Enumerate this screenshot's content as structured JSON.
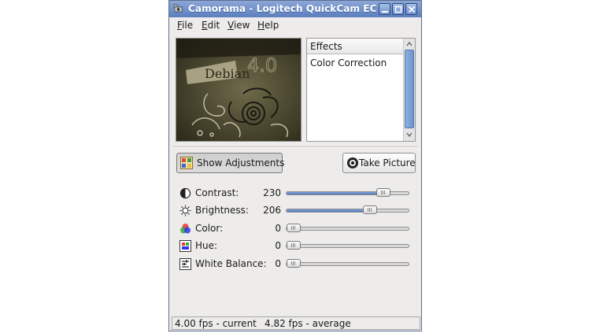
{
  "window": {
    "title": "Camorama - Logitech QuickCam EC"
  },
  "menubar": [
    {
      "label": "File",
      "mnemonic": "F",
      "rest": "ile"
    },
    {
      "label": "Edit",
      "mnemonic": "E",
      "rest": "dit"
    },
    {
      "label": "View",
      "mnemonic": "V",
      "rest": "iew"
    },
    {
      "label": "Help",
      "mnemonic": "H",
      "rest": "elp"
    }
  ],
  "preview": {
    "overlay_text": "Debian",
    "overlay_version": "4.0"
  },
  "effects": {
    "header": "Effects",
    "items": [
      "Color Correction"
    ]
  },
  "buttons": {
    "show_adjustments": "Show Adjustments",
    "take_picture": "Take Picture"
  },
  "adjustments": [
    {
      "label": "Contrast:",
      "value": "230",
      "level": 0.832,
      "icon": "contrast-icon"
    },
    {
      "label": "Brightness:",
      "value": "206",
      "level": 0.706,
      "icon": "brightness-icon"
    },
    {
      "label": "Color:",
      "value": "0",
      "level": 0,
      "icon": "color-wheel-icon"
    },
    {
      "label": "Hue:",
      "value": "0",
      "level": 0,
      "icon": "hue-icon"
    },
    {
      "label": "White Balance:",
      "value": "0",
      "level": 0,
      "icon": "white-balance-icon"
    }
  ],
  "status": {
    "current": "4.00 fps - current",
    "average": "4.82 fps - average"
  },
  "colors": {
    "titlebar": "#5a7fc0",
    "slider_fill": "#4f78be",
    "window_bg": "#edeceb"
  }
}
